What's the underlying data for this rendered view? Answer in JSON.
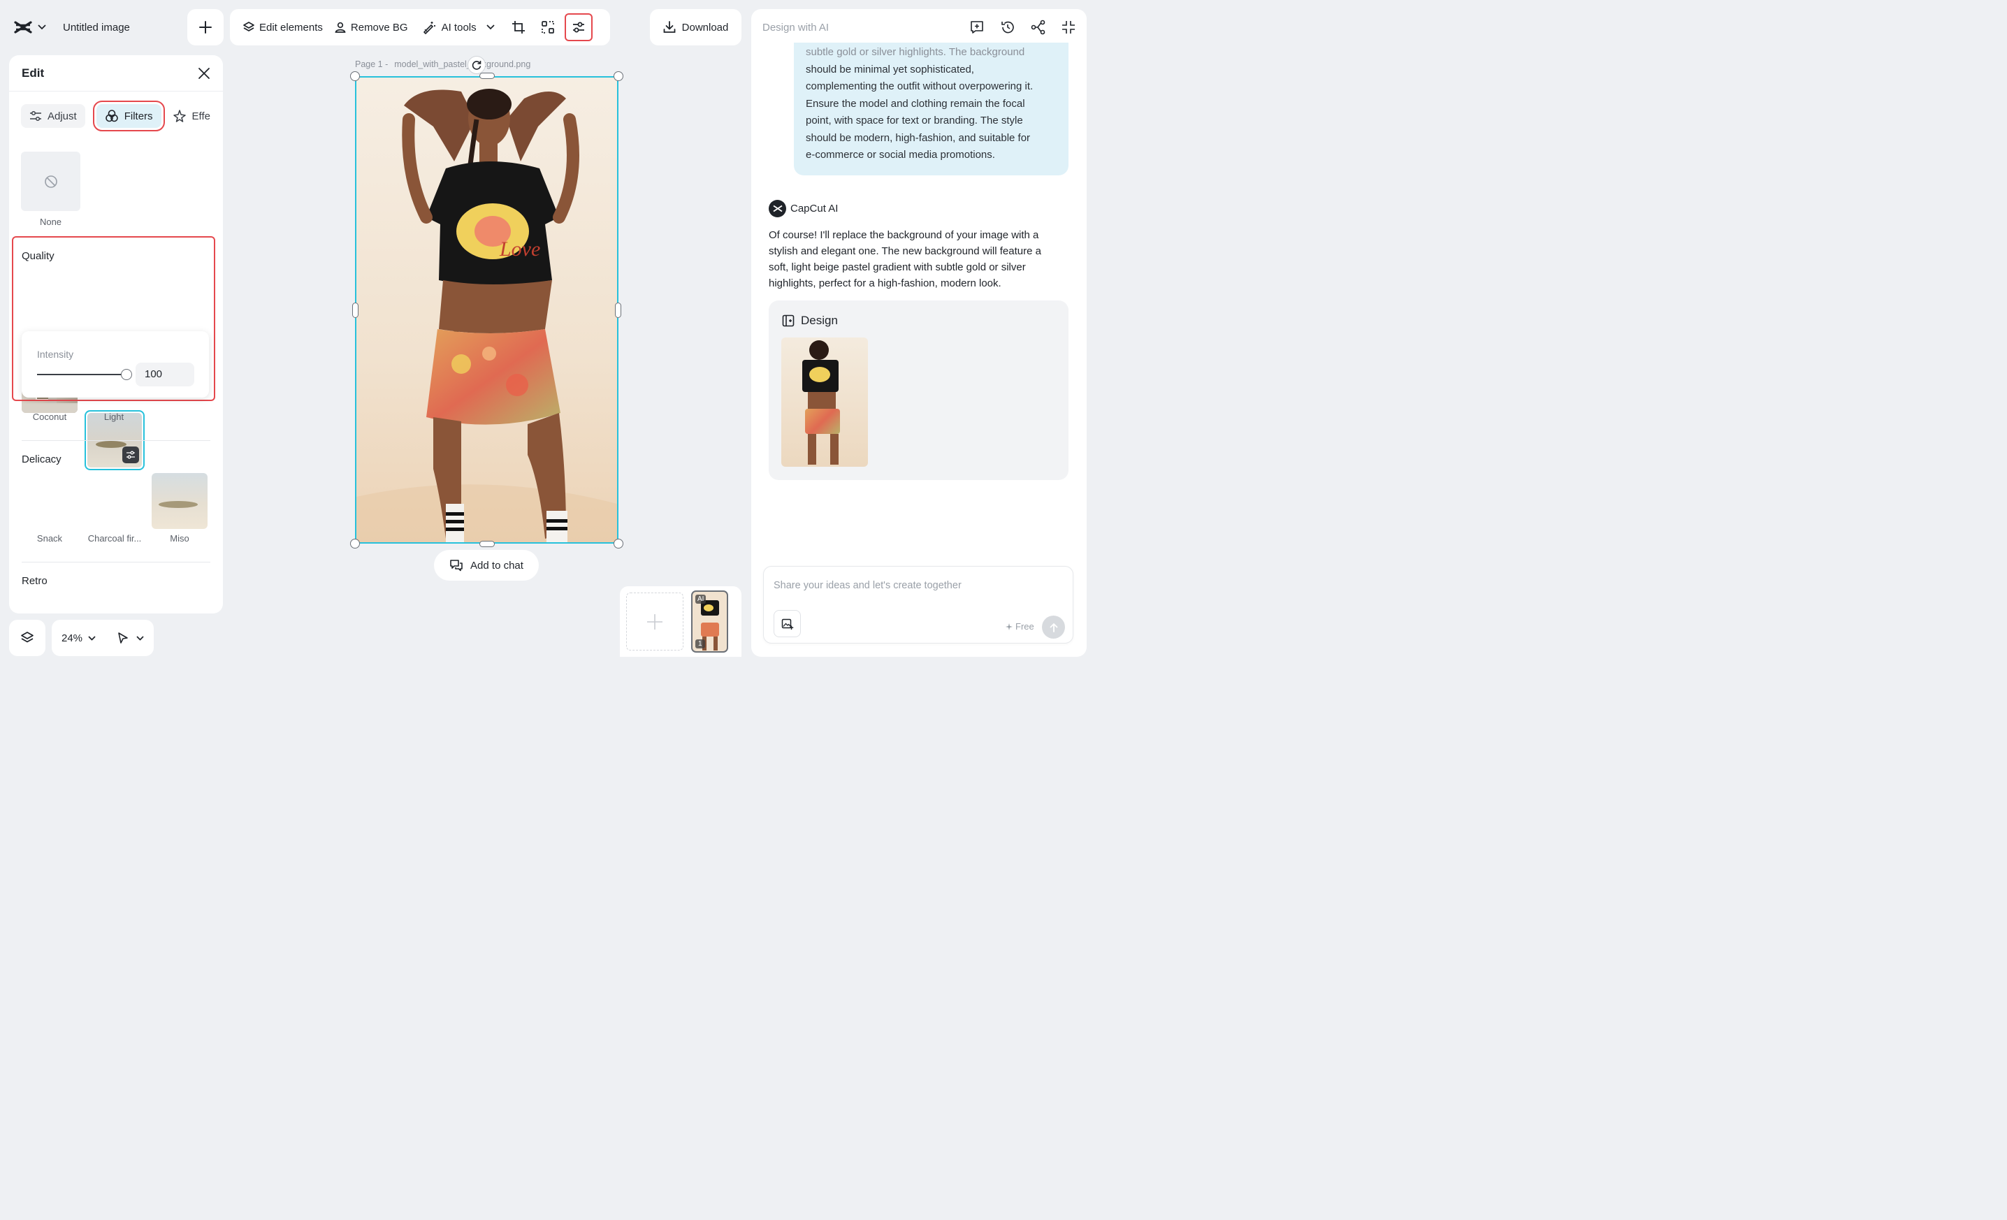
{
  "app": {
    "title": "Untitled image"
  },
  "toolbar": {
    "edit_elements": "Edit elements",
    "remove_bg": "Remove BG",
    "ai_tools": "AI tools",
    "download": "Download"
  },
  "edit_panel": {
    "title": "Edit",
    "tabs": [
      "Adjust",
      "Filters",
      "Effe"
    ],
    "none_label": "None",
    "quality": {
      "title": "Quality",
      "items": [
        "Coconut",
        "Light",
        ""
      ]
    },
    "intensity": {
      "label": "Intensity",
      "value": "100",
      "level": 1.0
    },
    "delicacy": {
      "title": "Delicacy",
      "items": [
        "Snack",
        "Charcoal fir...",
        "Miso"
      ]
    },
    "retro": {
      "title": "Retro"
    }
  },
  "bottom_bar": {
    "zoom": "24%"
  },
  "canvas": {
    "page_prefix": "Page 1 -",
    "file_name": "model_with_pastel_",
    "file_name_tail": "kground.png",
    "add_to_chat": "Add to chat"
  },
  "pages": {
    "page_number": "1",
    "ai_badge": "AI"
  },
  "ai_panel": {
    "title": "Design with AI",
    "user_message_lines": [
      "subtle gold or silver highlights. The background",
      "should be minimal yet sophisticated,",
      "complementing the outfit without overpowering it.",
      "Ensure the model and clothing remain the focal",
      "point, with space for text or branding. The style",
      "should be modern, high-fashion, and suitable for",
      "e-commerce or social media promotions."
    ],
    "assistant_name": "CapCut AI",
    "assistant_lines": [
      "Of course! I'll replace the background of your image with a",
      "stylish and elegant one. The new background will feature a",
      "soft, light beige pastel gradient with subtle gold or silver",
      "highlights, perfect for a high-fashion, modern look."
    ],
    "design_label": "Design",
    "input_placeholder": "Share your ideas and let's create together",
    "free_label": "Free"
  },
  "colors": {
    "accent": "#27c1db",
    "highlight": "#e5484d",
    "bubble": "#dff1f8"
  }
}
